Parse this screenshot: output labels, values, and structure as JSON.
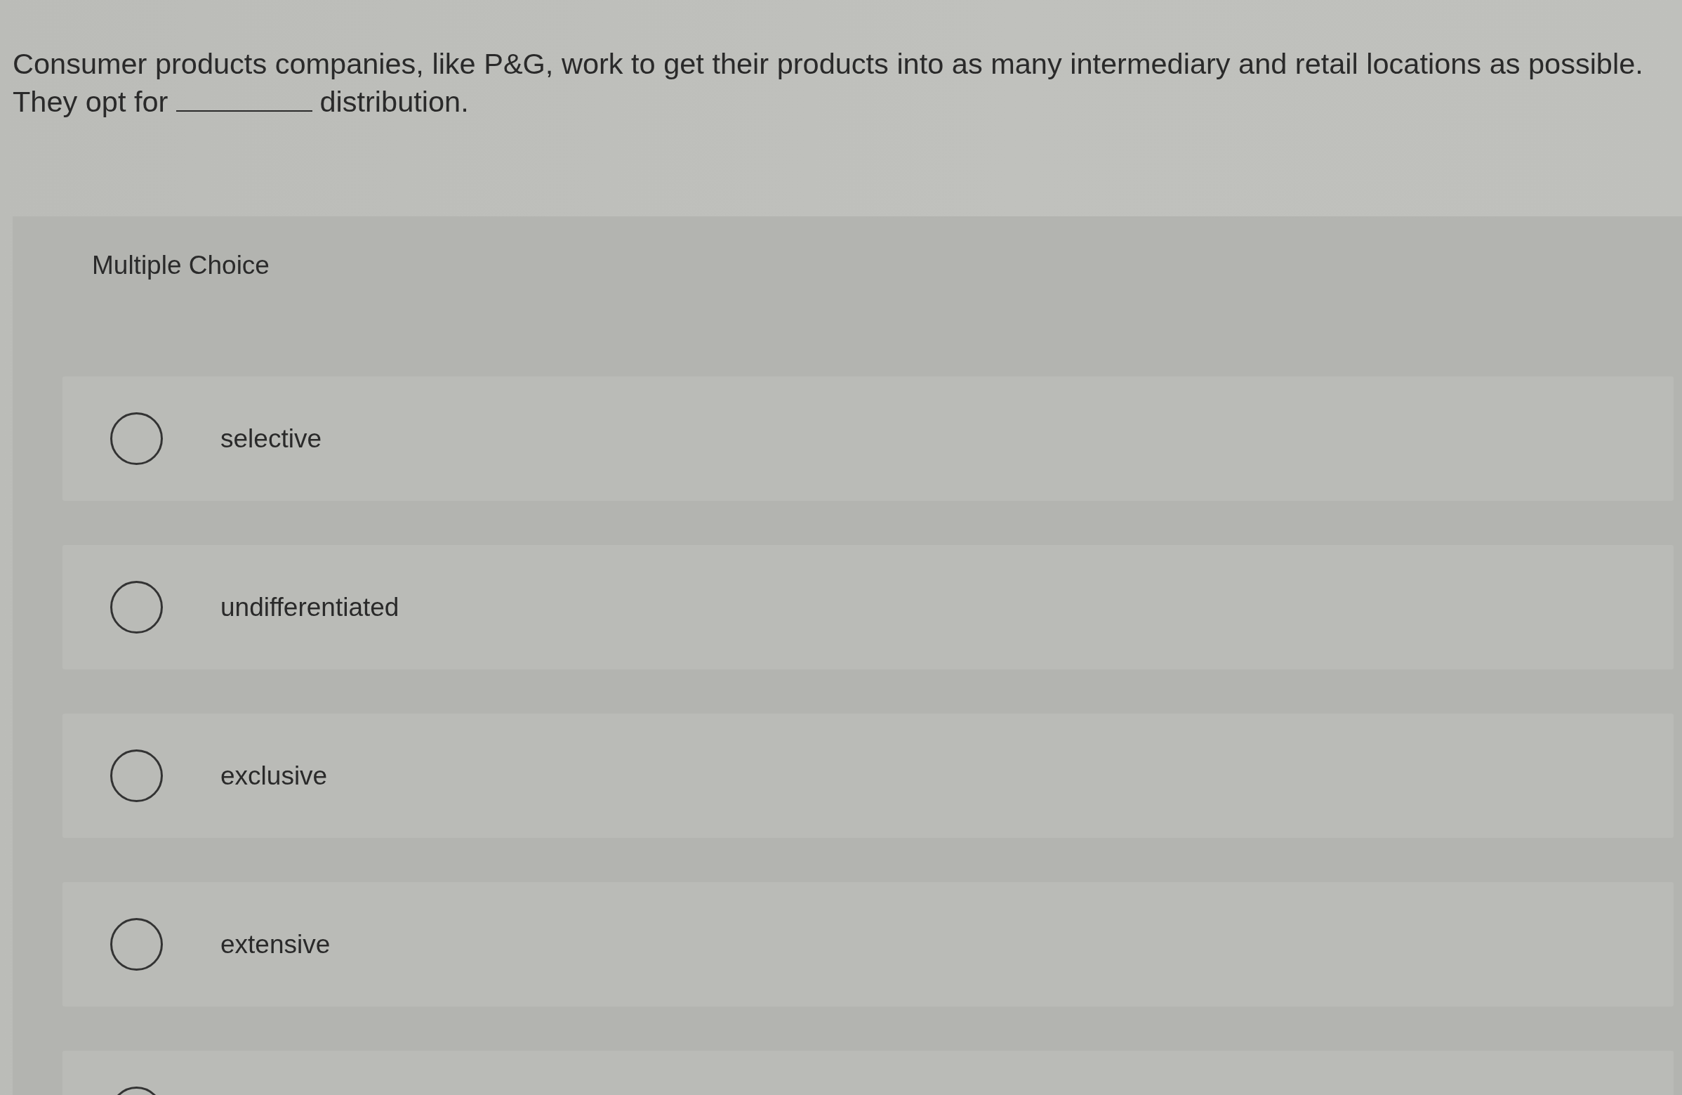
{
  "question": {
    "sentence": "Consumer products companies, like P&G, work to get their products into as many intermediary and retail locations as possible.",
    "prompt_before": "They opt for",
    "prompt_after": "distribution."
  },
  "card": {
    "heading": "Multiple Choice",
    "options": [
      {
        "label": "selective",
        "selected": false
      },
      {
        "label": "undifferentiated",
        "selected": false
      },
      {
        "label": "exclusive",
        "selected": false
      },
      {
        "label": "extensive",
        "selected": false
      },
      {
        "selected": false
      }
    ]
  }
}
